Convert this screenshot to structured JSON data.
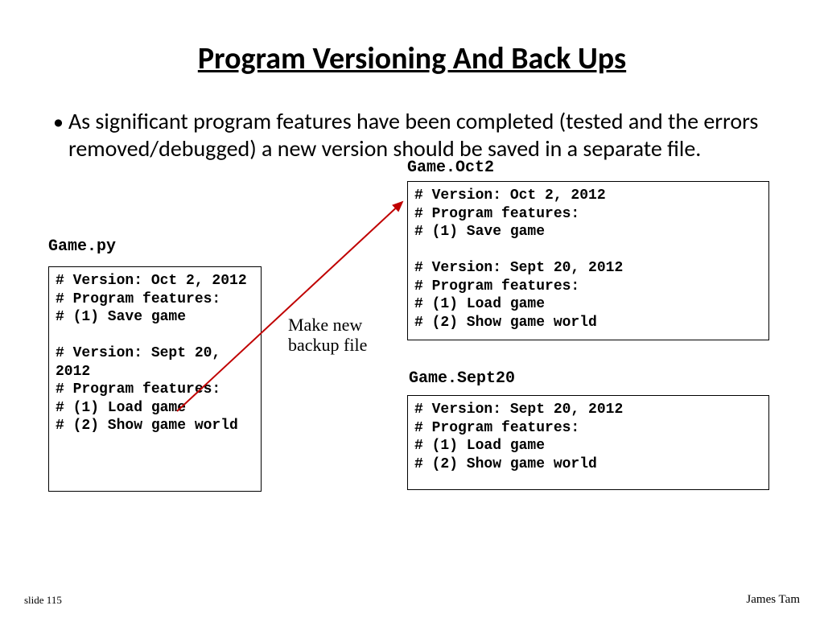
{
  "title": "Program Versioning And Back Ups",
  "bullet": "As significant program features have been completed (tested and the errors removed/debugged) a new version should be saved in a separate file.",
  "labels": {
    "gamepy": "Game.py",
    "gameoct2": "Game.Oct2",
    "gamesept20": "Game.Sept20",
    "makenew": "Make new\nbackup file"
  },
  "code": {
    "left_box": "# Version: Oct 2, 2012\n# Program features:\n# (1) Save game\n\n# Version: Sept 20, 2012\n# Program features:\n# (1) Load game\n# (2) Show game world",
    "right_top": "# Version: Oct 2, 2012\n# Program features:\n# (1) Save game\n\n# Version: Sept 20, 2012\n# Program features:\n# (1) Load game\n# (2) Show game world",
    "right_bottom": "# Version: Sept 20, 2012\n# Program features:\n# (1) Load game\n# (2) Show game world"
  },
  "footer": {
    "slide": "slide 115",
    "author": "James Tam"
  }
}
